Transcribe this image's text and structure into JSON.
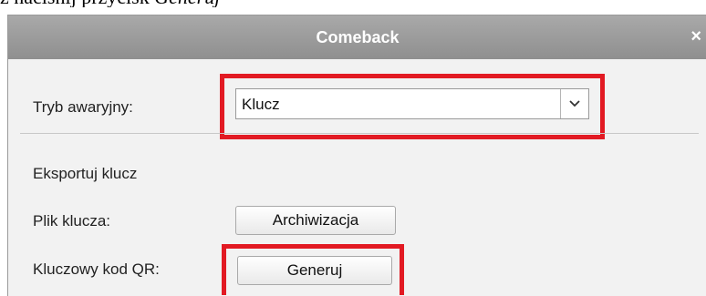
{
  "caption": {
    "text": "ż naciśnij przycisk ",
    "italic": "Generuj"
  },
  "dialog": {
    "title": "Comeback",
    "close_glyph": "×"
  },
  "emergency_mode": {
    "label": "Tryb awaryjny:",
    "selected": "Klucz"
  },
  "export": {
    "section_label": "Eksportuj klucz",
    "key_file_label": "Plik klucza:",
    "backup_button": "Archiwizacja",
    "qr_label": "Kluczowy kod QR:",
    "generate_button": "Generuj"
  },
  "colors": {
    "highlight": "#e21a23",
    "titlebar": "#9c9c9c",
    "dialog_bg": "#f2f2f2"
  }
}
